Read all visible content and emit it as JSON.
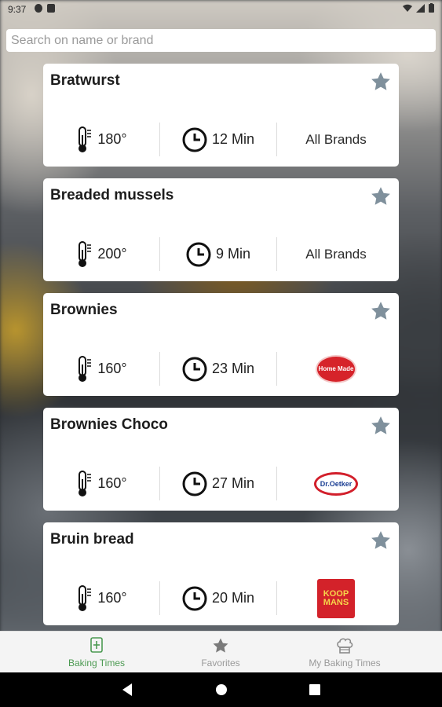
{
  "status_bar": {
    "time": "9:37"
  },
  "search": {
    "placeholder": "Search on name or brand",
    "value": ""
  },
  "items": [
    {
      "name": "Bratwurst",
      "temperature": "180°",
      "time": "12 Min",
      "brand": "All Brands",
      "brand_type": "text"
    },
    {
      "name": "Breaded mussels",
      "temperature": "200°",
      "time": "9 Min",
      "brand": "All Brands",
      "brand_type": "text"
    },
    {
      "name": "Brownies",
      "temperature": "160°",
      "time": "23 Min",
      "brand": "Home Made",
      "brand_type": "logo-homemade"
    },
    {
      "name": "Brownies Choco",
      "temperature": "160°",
      "time": "27 Min",
      "brand": "Dr.Oetker",
      "brand_type": "logo-droetker"
    },
    {
      "name": "Bruin bread",
      "temperature": "160°",
      "time": "20 Min",
      "brand": "KOOP MANS",
      "brand_type": "logo-koopmans"
    }
  ],
  "bottom_nav": {
    "tabs": [
      {
        "label": "Baking Times",
        "icon": "oven-tray-icon",
        "active": true
      },
      {
        "label": "Favorites",
        "icon": "star-icon",
        "active": false
      },
      {
        "label": "My Baking Times",
        "icon": "chef-hat-icon",
        "active": false
      }
    ]
  },
  "colors": {
    "star": "#7f909c",
    "active_tab": "#4c9a52",
    "inactive_tab": "#9a9a9a",
    "card_bg": "#ffffff"
  }
}
